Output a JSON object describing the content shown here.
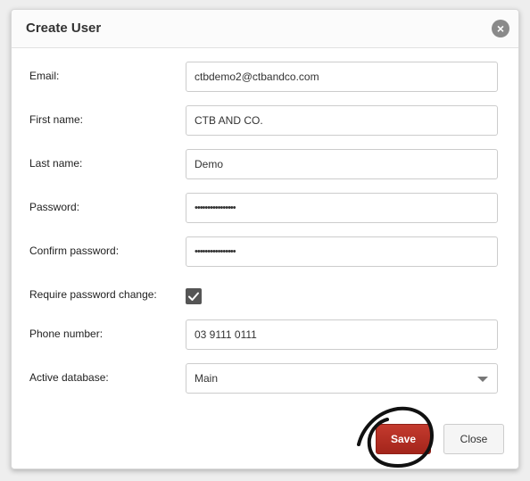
{
  "dialog": {
    "title": "Create User",
    "close_icon": "close-icon"
  },
  "form": {
    "email": {
      "label": "Email:",
      "value": "ctbdemo2@ctbandco.com"
    },
    "first_name": {
      "label": "First name:",
      "value": "CTB AND CO."
    },
    "last_name": {
      "label": "Last name:",
      "value": "Demo"
    },
    "password": {
      "label": "Password:",
      "value": "••••••••••••••••"
    },
    "confirm_password": {
      "label": "Confirm password:",
      "value": "••••••••••••••••"
    },
    "require_password_change": {
      "label": "Require password change:",
      "checked": true
    },
    "phone": {
      "label": "Phone number:",
      "value": "03 9111 0111"
    },
    "active_database": {
      "label": "Active database:",
      "selected": "Main"
    }
  },
  "buttons": {
    "save_label": "Save",
    "close_label": "Close"
  },
  "colors": {
    "save_button": "#b22d22",
    "checkbox": "#555555"
  }
}
